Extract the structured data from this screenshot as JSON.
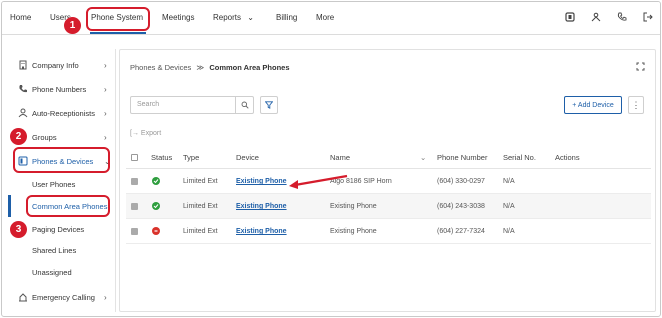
{
  "topnav": {
    "items": [
      {
        "label": "Home"
      },
      {
        "label": "Users"
      },
      {
        "label": "Phone System"
      },
      {
        "label": "Meetings"
      },
      {
        "label": "Reports"
      },
      {
        "label": "Billing"
      },
      {
        "label": "More"
      }
    ],
    "icons": [
      "agent-icon",
      "user-icon",
      "phone-icon",
      "logout-icon"
    ]
  },
  "sidebar": {
    "items": [
      {
        "label": "Company Info",
        "icon": "building-icon"
      },
      {
        "label": "Phone Numbers",
        "icon": "phone-numbers-icon"
      },
      {
        "label": "Auto-Receptionists",
        "icon": "receptionist-icon"
      },
      {
        "label": "Groups",
        "icon": "groups-icon"
      },
      {
        "label": "Phones & Devices",
        "icon": "desk-phone-icon"
      },
      {
        "label": "Emergency Calling",
        "icon": "emergency-icon"
      }
    ],
    "subitems": [
      {
        "label": "User Phones"
      },
      {
        "label": "Common Area Phones"
      },
      {
        "label": "Paging Devices"
      },
      {
        "label": "Shared Lines"
      },
      {
        "label": "Unassigned"
      }
    ]
  },
  "breadcrumb": {
    "parent": "Phones & Devices",
    "separator": "≫",
    "current": "Common Area Phones"
  },
  "toolbar": {
    "search_placeholder": "Search",
    "add_label": "+ Add Device",
    "export_label": "Export",
    "more_label": "⋮"
  },
  "table": {
    "columns": [
      "Status",
      "Type",
      "Device",
      "Name",
      "Phone Number",
      "Serial No.",
      "Actions"
    ],
    "rows": [
      {
        "status": "online",
        "type": "Limited Ext",
        "device": "Existing Phone",
        "name": "Algo 8186 SIP Horn",
        "phone": "(604) 330-0297",
        "serial": "N/A"
      },
      {
        "status": "online",
        "type": "Limited Ext",
        "device": "Existing Phone",
        "name": "Existing Phone",
        "phone": "(604) 243-3038",
        "serial": "N/A"
      },
      {
        "status": "offline",
        "type": "Limited Ext",
        "device": "Existing Phone",
        "name": "Existing Phone",
        "phone": "(604) 227-7324",
        "serial": "N/A"
      }
    ]
  },
  "callouts": [
    "1",
    "2",
    "3"
  ],
  "colors": {
    "accent": "#1e5fa8",
    "callout": "#d51c2c",
    "online": "#2e9e3e",
    "offline": "#d9322b"
  }
}
